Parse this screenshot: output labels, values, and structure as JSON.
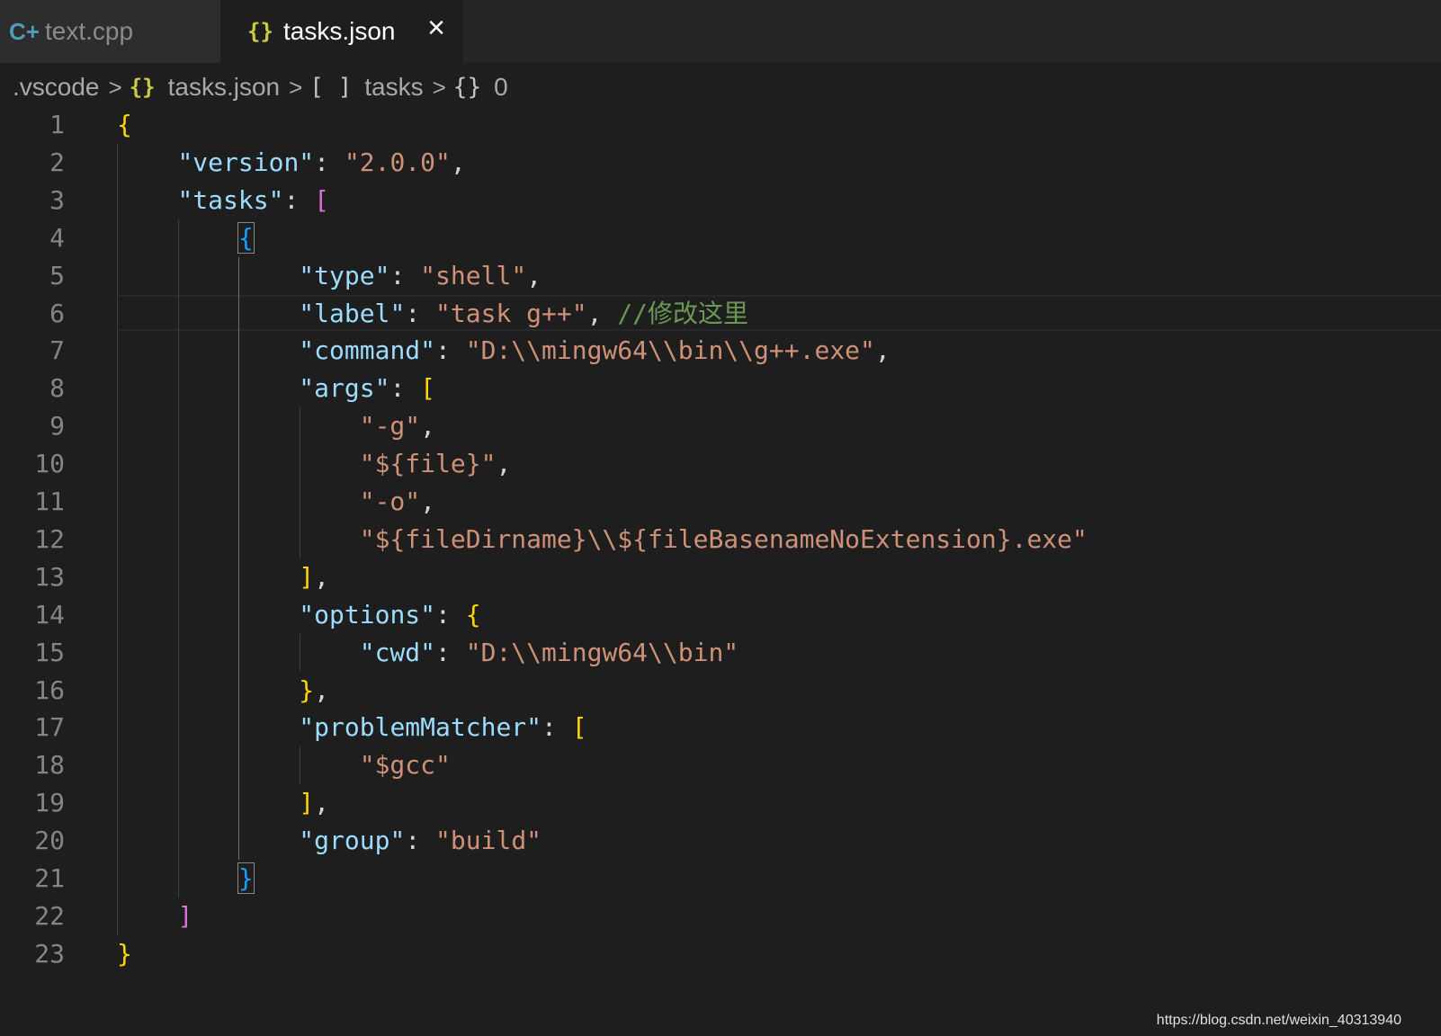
{
  "tabs": [
    {
      "icon": "cpp-file-icon",
      "icon_text": "C+",
      "label": "text.cpp",
      "active": false
    },
    {
      "icon": "json-file-icon",
      "icon_text": "{}",
      "label": "tasks.json",
      "active": true,
      "close_glyph": "×"
    }
  ],
  "breadcrumb": {
    "folder": ".vscode",
    "file": "tasks.json",
    "file_icon": "{}",
    "array_symbol": "[ ]",
    "array_name": "tasks",
    "object_symbol": "{}",
    "object_name": "0",
    "separator": ">"
  },
  "editor": {
    "line_numbers": [
      "1",
      "2",
      "3",
      "4",
      "5",
      "6",
      "7",
      "8",
      "9",
      "10",
      "11",
      "12",
      "13",
      "14",
      "15",
      "16",
      "17",
      "18",
      "19",
      "20",
      "21",
      "22",
      "23"
    ],
    "current_line": "6",
    "lines": [
      [
        {
          "t": "{",
          "c": "b1"
        }
      ],
      [
        {
          "t": "    "
        },
        {
          "t": "\"version\"",
          "c": "k"
        },
        {
          "t": ": "
        },
        {
          "t": "\"2.0.0\"",
          "c": "s"
        },
        {
          "t": ","
        }
      ],
      [
        {
          "t": "    "
        },
        {
          "t": "\"tasks\"",
          "c": "k"
        },
        {
          "t": ": "
        },
        {
          "t": "[",
          "c": "b2"
        }
      ],
      [
        {
          "t": "        "
        },
        {
          "t": "{",
          "c": "b3 bm"
        }
      ],
      [
        {
          "t": "            "
        },
        {
          "t": "\"type\"",
          "c": "k"
        },
        {
          "t": ": "
        },
        {
          "t": "\"shell\"",
          "c": "s"
        },
        {
          "t": ","
        }
      ],
      [
        {
          "t": "            "
        },
        {
          "t": "\"label\"",
          "c": "k"
        },
        {
          "t": ": "
        },
        {
          "t": "\"task g++\"",
          "c": "s"
        },
        {
          "t": ", "
        },
        {
          "t": "//修改这里",
          "c": "c"
        }
      ],
      [
        {
          "t": "            "
        },
        {
          "t": "\"command\"",
          "c": "k"
        },
        {
          "t": ": "
        },
        {
          "t": "\"D:\\\\mingw64\\\\bin\\\\g++.exe\"",
          "c": "s"
        },
        {
          "t": ","
        }
      ],
      [
        {
          "t": "            "
        },
        {
          "t": "\"args\"",
          "c": "k"
        },
        {
          "t": ": "
        },
        {
          "t": "[",
          "c": "b1"
        }
      ],
      [
        {
          "t": "                "
        },
        {
          "t": "\"-g\"",
          "c": "s"
        },
        {
          "t": ","
        }
      ],
      [
        {
          "t": "                "
        },
        {
          "t": "\"${file}\"",
          "c": "s"
        },
        {
          "t": ","
        }
      ],
      [
        {
          "t": "                "
        },
        {
          "t": "\"-o\"",
          "c": "s"
        },
        {
          "t": ","
        }
      ],
      [
        {
          "t": "                "
        },
        {
          "t": "\"${fileDirname}\\\\${fileBasenameNoExtension}.exe\"",
          "c": "s"
        }
      ],
      [
        {
          "t": "            "
        },
        {
          "t": "]",
          "c": "b1"
        },
        {
          "t": ","
        }
      ],
      [
        {
          "t": "            "
        },
        {
          "t": "\"options\"",
          "c": "k"
        },
        {
          "t": ": "
        },
        {
          "t": "{",
          "c": "b1"
        }
      ],
      [
        {
          "t": "                "
        },
        {
          "t": "\"cwd\"",
          "c": "k"
        },
        {
          "t": ": "
        },
        {
          "t": "\"D:\\\\mingw64\\\\bin\"",
          "c": "s"
        }
      ],
      [
        {
          "t": "            "
        },
        {
          "t": "}",
          "c": "b1"
        },
        {
          "t": ","
        }
      ],
      [
        {
          "t": "            "
        },
        {
          "t": "\"problemMatcher\"",
          "c": "k"
        },
        {
          "t": ": "
        },
        {
          "t": "[",
          "c": "b1"
        }
      ],
      [
        {
          "t": "                "
        },
        {
          "t": "\"$gcc\"",
          "c": "s"
        }
      ],
      [
        {
          "t": "            "
        },
        {
          "t": "]",
          "c": "b1"
        },
        {
          "t": ","
        }
      ],
      [
        {
          "t": "            "
        },
        {
          "t": "\"group\"",
          "c": "k"
        },
        {
          "t": ": "
        },
        {
          "t": "\"build\"",
          "c": "s"
        }
      ],
      [
        {
          "t": "        "
        },
        {
          "t": "}",
          "c": "b3 bm"
        }
      ],
      [
        {
          "t": "    "
        },
        {
          "t": "]",
          "c": "b2"
        }
      ],
      [
        {
          "t": "}",
          "c": "b1"
        }
      ]
    ]
  },
  "watermark": "https://blog.csdn.net/weixin_40313940"
}
